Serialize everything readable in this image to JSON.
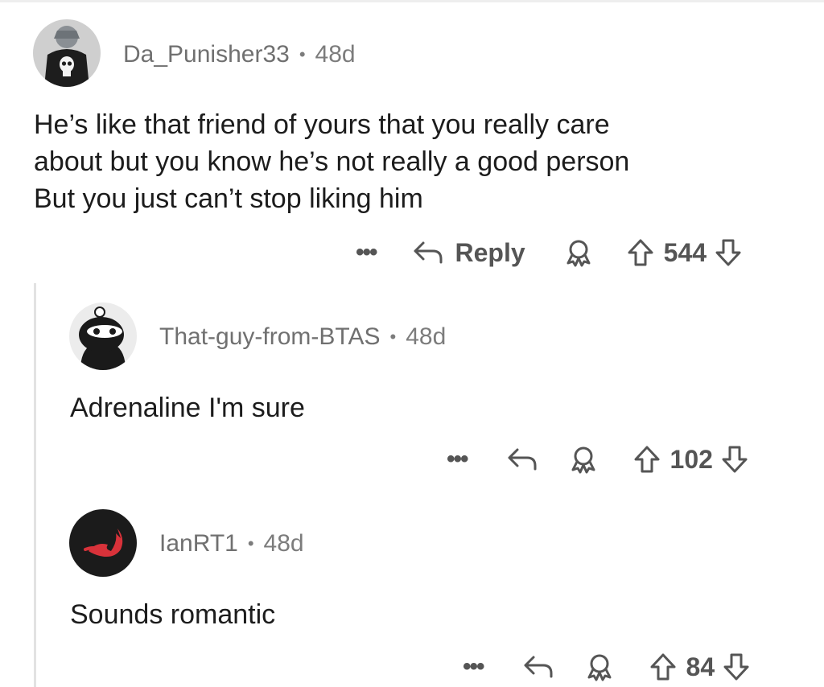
{
  "comments": [
    {
      "author": "Da_Punisher33",
      "separator": "•",
      "age": "48d",
      "text_lines": [
        "He’s like that friend of yours that you really care",
        "about but you know he’s not really a good person",
        "But you just can’t stop liking him"
      ],
      "reply_label": "Reply",
      "score": "544",
      "more_label": "•••",
      "avatar_icon": "punisher-avatar-icon"
    },
    {
      "author": "That-guy-from-BTAS",
      "separator": "•",
      "age": "48d",
      "text_lines": [
        "Adrenaline I'm sure"
      ],
      "score": "102",
      "more_label": "•••",
      "avatar_icon": "snoo-avatar-icon"
    },
    {
      "author": "IanRT1",
      "separator": "•",
      "age": "48d",
      "text_lines": [
        "Sounds romantic"
      ],
      "score": "84",
      "more_label": "•••",
      "avatar_icon": "fox-avatar-icon"
    }
  ],
  "colors": {
    "text": "#1c1c1c",
    "meta": "#7c7c7c",
    "action": "#555555",
    "thread_line": "#e2e2e2"
  }
}
